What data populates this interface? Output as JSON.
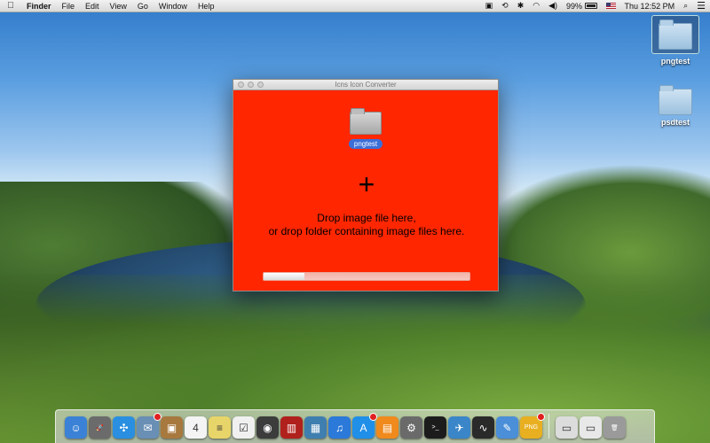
{
  "menubar": {
    "app_name": "Finder",
    "items": [
      "File",
      "Edit",
      "View",
      "Go",
      "Window",
      "Help"
    ],
    "battery": "99%",
    "clock": "Thu 12:52 PM"
  },
  "desktop": {
    "icons": [
      {
        "label": "pngtest",
        "selected": true
      },
      {
        "label": "psdtest",
        "selected": false
      }
    ]
  },
  "window": {
    "title": "Icns Icon Converter",
    "background_color": "#ff2600",
    "dropped_item_label": "pngtest",
    "plus_symbol": "+",
    "drop_line_1": "Drop image file here,",
    "drop_line_2": "or drop folder containing image files here.",
    "progress_fraction": 0.2
  },
  "dock": {
    "items": [
      {
        "name": "finder",
        "glyph": "☺",
        "color": "#3b82d6"
      },
      {
        "name": "launchpad",
        "glyph": "🚀",
        "color": "#6b6b6b"
      },
      {
        "name": "safari",
        "glyph": "✣",
        "color": "#2a8fe0"
      },
      {
        "name": "mail",
        "glyph": "✉",
        "color": "#6a8fb5",
        "badge": true
      },
      {
        "name": "contacts",
        "glyph": "▣",
        "color": "#a8793f"
      },
      {
        "name": "calendar",
        "glyph": "4",
        "color": "#f4f4f4"
      },
      {
        "name": "notes",
        "glyph": "≡",
        "color": "#e8d56a"
      },
      {
        "name": "reminders",
        "glyph": "☑",
        "color": "#f0f0f0"
      },
      {
        "name": "facetime",
        "glyph": "◉",
        "color": "#3c3c3c"
      },
      {
        "name": "photo-booth",
        "glyph": "▥",
        "color": "#b0201c"
      },
      {
        "name": "iphoto",
        "glyph": "▦",
        "color": "#3f7fb0"
      },
      {
        "name": "itunes",
        "glyph": "♫",
        "color": "#2b79d9"
      },
      {
        "name": "app-store",
        "glyph": "A",
        "color": "#1f8fe8",
        "badge": true
      },
      {
        "name": "ibooks",
        "glyph": "▤",
        "color": "#f08a1c"
      },
      {
        "name": "system-preferences",
        "glyph": "⚙",
        "color": "#6a6a6a"
      },
      {
        "name": "terminal",
        "glyph": ">_",
        "color": "#1c1c1c"
      },
      {
        "name": "xcode",
        "glyph": "✈",
        "color": "#3a86c8"
      },
      {
        "name": "activity-monitor",
        "glyph": "∿",
        "color": "#2a2a2a"
      },
      {
        "name": "xcode-tools",
        "glyph": "✎",
        "color": "#4a8fd8"
      },
      {
        "name": "icns-converter",
        "glyph": "PNG",
        "color": "#e8b020",
        "badge": true
      }
    ],
    "right_items": [
      {
        "name": "preview",
        "glyph": "▭",
        "color": "#dcdcdc"
      },
      {
        "name": "documents-stack",
        "glyph": "▭",
        "color": "#e8e8e8"
      },
      {
        "name": "trash",
        "glyph": "🗑",
        "color": "#9a9a9a"
      }
    ]
  }
}
